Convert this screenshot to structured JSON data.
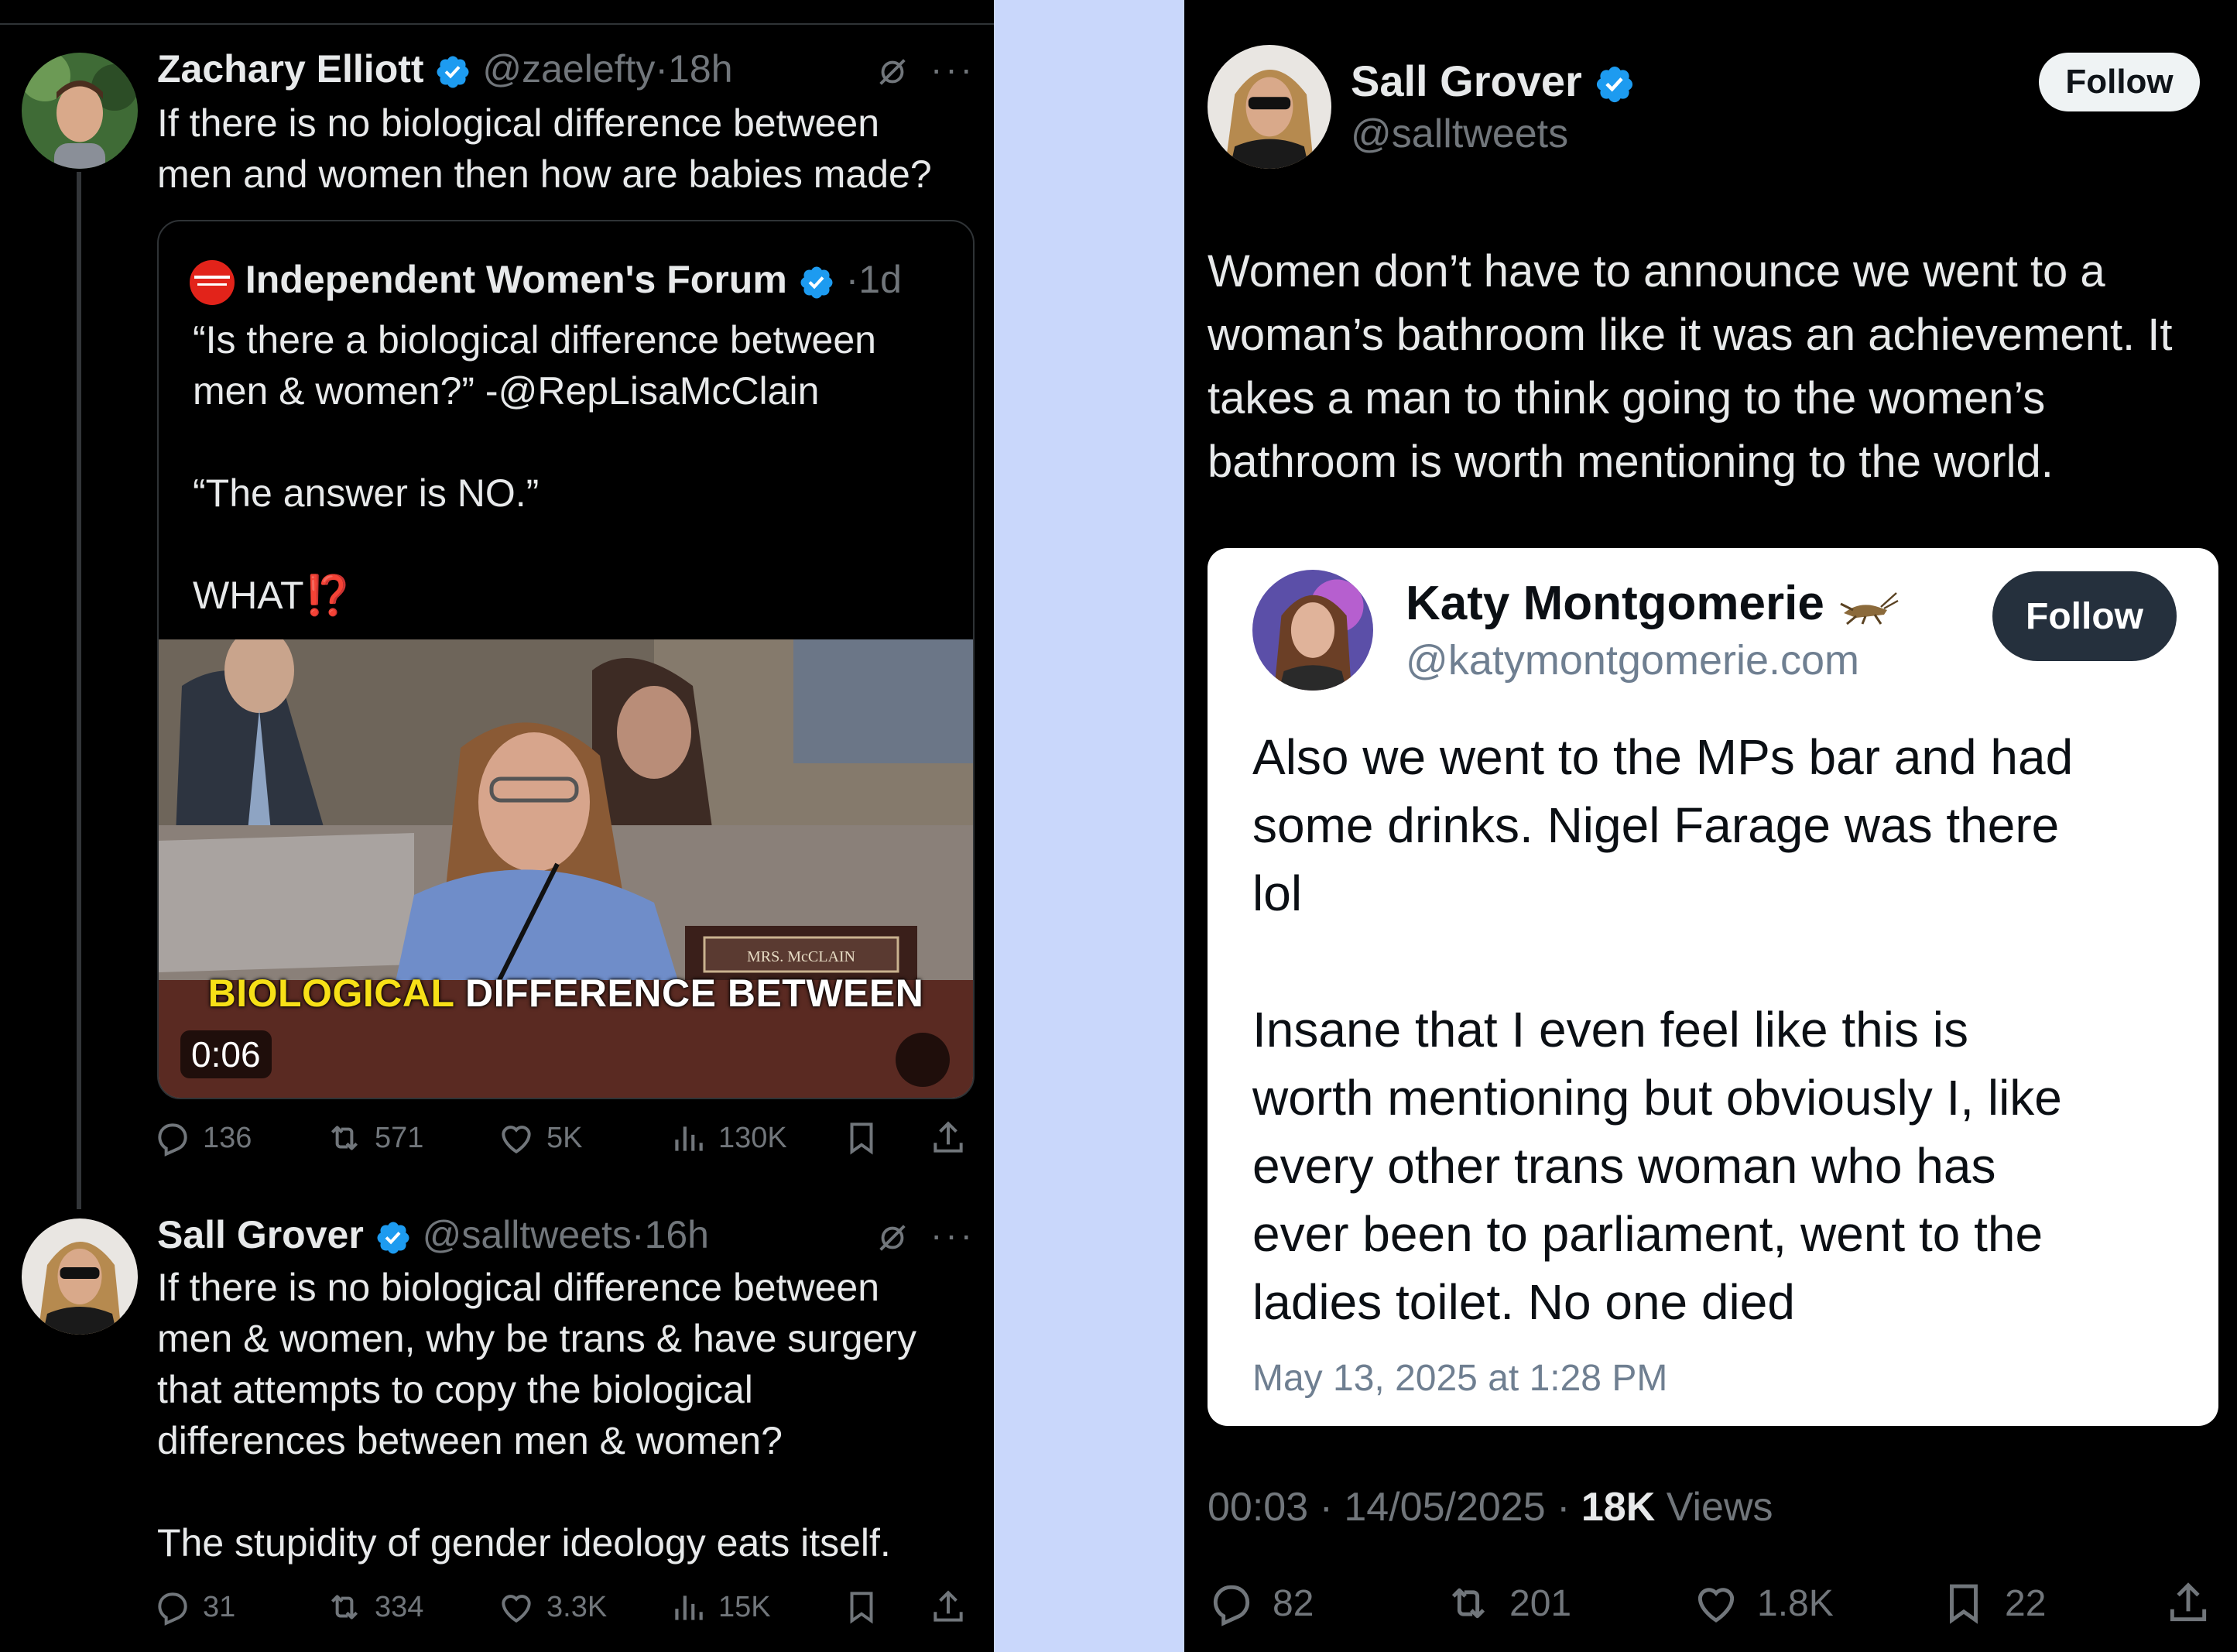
{
  "colors": {
    "x_blue": "#1d9bf0",
    "muted": "#71767b",
    "bg": "#000000",
    "divider": "#c9d7fb",
    "red_exclaim": "#f4212e"
  },
  "left": {
    "tweet1": {
      "name": "Zachary Elliott",
      "handle": "@zaelefty",
      "sep": "·",
      "time": "18h",
      "text": "If there is no biological difference between\nmen and women then how are babies made?",
      "more": "···"
    },
    "quote": {
      "name": "Independent Women's Forum",
      "sep": "·",
      "time": "1d",
      "text": "“Is there a biological difference between\nmen & women?” -@RepLisaMcClain\n\n“The answer is NO.”\n\nWHAT",
      "emoji": "⁉️",
      "video": {
        "caption_highlight": "BIOLOGICAL",
        "caption_rest": "DIFFERENCE BETWEEN",
        "timer": "0:06",
        "nameplate": "MRS. McCLAIN",
        "mute_icon": "speaker-muted-icon"
      }
    },
    "tweet1_actions": {
      "replies": "136",
      "reposts": "571",
      "likes": "5K",
      "views": "130K"
    },
    "tweet2": {
      "name": "Sall Grover",
      "handle": "@salltweets",
      "sep": "·",
      "time": "16h",
      "text": "If there is no biological difference between\nmen & women, why be trans & have surgery\nthat attempts to copy the biological\ndifferences between men & women?\n\nThe stupidity of gender ideology eats itself.",
      "more": "···"
    },
    "tweet2_actions": {
      "replies": "31",
      "reposts": "334",
      "likes": "3.3K",
      "views": "15K"
    }
  },
  "right": {
    "name": "Sall Grover",
    "handle": "@salltweets",
    "follow": "Follow",
    "text": "Women don’t have to announce we went to a woman’s bathroom like it was an achievement. It takes a man to think going to the women’s bathroom is worth mentioning to the world.",
    "embed": {
      "name": "Katy Montgomerie",
      "name_emoji_icon": "cricket-icon",
      "handle": "@katymontgomerie.com",
      "follow": "Follow",
      "text": "Also we went to the MPs bar and had\nsome drinks. Nigel Farage was there\nlol\n\nInsane that I even feel like this is\nworth mentioning but obviously I, like\nevery other trans woman who has\never been to parliament, went to the\nladies toilet. No one died",
      "date": "May 13, 2025 at 1:28 PM"
    },
    "meta": {
      "time": "00:03",
      "sep": "·",
      "date": "14/05/2025",
      "views_count": "18K",
      "views_label": "Views"
    },
    "actions": {
      "replies": "82",
      "reposts": "201",
      "likes": "1.8K",
      "bookmarks": "22"
    }
  }
}
